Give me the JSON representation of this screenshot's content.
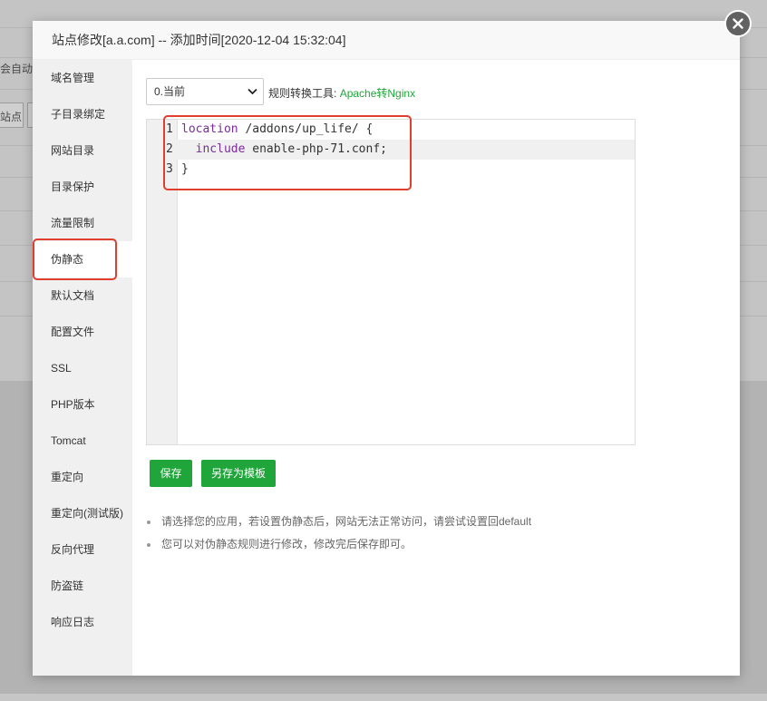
{
  "background": {
    "fragment_1": "会自动创",
    "fragment_2": "站点"
  },
  "modal": {
    "title": "站点修改[a.a.com] -- 添加时间[2020-12-04 15:32:04]",
    "close_icon": "close-icon"
  },
  "sidebar": {
    "items": [
      {
        "label": "域名管理"
      },
      {
        "label": "子目录绑定"
      },
      {
        "label": "网站目录"
      },
      {
        "label": "目录保护"
      },
      {
        "label": "流量限制"
      },
      {
        "label": "伪静态"
      },
      {
        "label": "默认文档"
      },
      {
        "label": "配置文件"
      },
      {
        "label": "SSL"
      },
      {
        "label": "PHP版本"
      },
      {
        "label": "Tomcat"
      },
      {
        "label": "重定向"
      },
      {
        "label": "重定向(测试版)"
      },
      {
        "label": "反向代理"
      },
      {
        "label": "防盗链"
      },
      {
        "label": "响应日志"
      }
    ],
    "active": "伪静态"
  },
  "rewrite": {
    "version_selected": "0.当前",
    "tool_label": "规则转换工具:",
    "tool_link": "Apache转Nginx",
    "code_lines": [
      {
        "num": "1",
        "keyword": "location",
        "rest": " /addons/up_life/ {"
      },
      {
        "num": "2",
        "keyword": "include",
        "rest": " enable-php-71.conf;"
      },
      {
        "num": "3",
        "keyword": "",
        "rest": "}"
      }
    ],
    "save_label": "保存",
    "save_as_template_label": "另存为模板",
    "tips": [
      "请选择您的应用，若设置伪静态后，网站无法正常访问，请尝试设置回default",
      "您可以对伪静态规则进行修改，修改完后保存即可。"
    ]
  },
  "colors": {
    "accent": "#20a53a",
    "annotation": "#e03e2f",
    "keyword": "#7b2b9c"
  }
}
